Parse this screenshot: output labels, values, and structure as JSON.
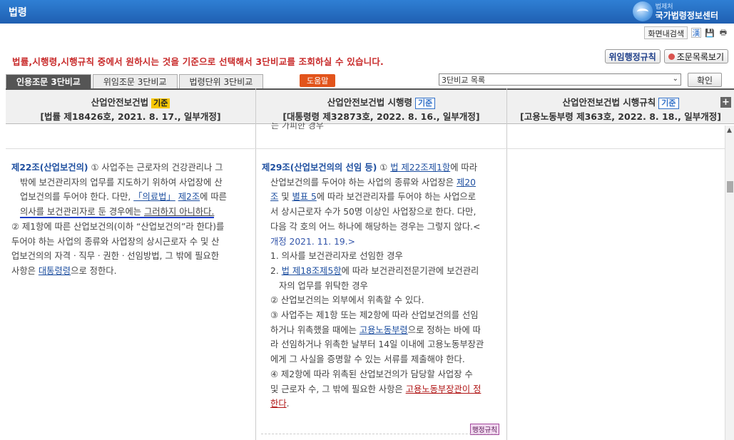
{
  "header": {
    "title": "법령",
    "brand_small": "법제처",
    "brand_big": "국가법령정보센터"
  },
  "tools": {
    "search_label": "화면내검색",
    "hanja_label": "漢",
    "save_label": "💾",
    "print_label": "🖶"
  },
  "notice": "법률,시행령,시행규칙 중에서 원하시는 것을 기준으로 선택해서 3단비교를 조회하실 수 있습니다.",
  "buttons": {
    "delegated_rules": "위임행정규칙",
    "article_list": "조문목록보기"
  },
  "tabs": [
    "인용조문 3단비교",
    "위임조문 3단비교",
    "법령단위 3단비교"
  ],
  "help_label": "도움말",
  "select": {
    "value": "3단비교 목록"
  },
  "confirm_label": "확인",
  "columns": [
    {
      "name": "산업안전보건법",
      "badge": "기준",
      "sub": "[법률 제18426호, 2021. 8. 17., 일부개정]"
    },
    {
      "name": "산업안전보건법 시행령",
      "badge": "기준",
      "sub": "[대통령령 제32873호, 2022. 8. 16., 일부개정]"
    },
    {
      "name": "산업안전보건법 시행규칙",
      "badge": "기준",
      "sub": "[고용노동부령 제363호, 2022. 8. 18., 일부개정]"
    }
  ],
  "cut_text": "는 가피한 경우",
  "law": {
    "title": "제22조(산업보건의)",
    "p1a": " ① 사업주는 근로자의 건강관리나 그",
    "p1b": "밖에 보건관리자의 업무를 지도하기 위하여 사업장에 산",
    "p1c": "업보건의를 두어야 한다. 다만, ",
    "link_medical": "「의료법」",
    "link_art2": "제2조",
    "p1d": "에 따른",
    "p1e_hl": "의사를 보건관리자로 둔 경우에는 ",
    "p1e_hl2": "그러하지 아니하다.",
    "p2a": "② 제1항에 따른 산업보건의(이하 “산업보건의”라 한다)를",
    "p2b": "두어야 하는 사업의 종류와 사업장의 상시근로자 수 및 산",
    "p2c": "업보건의의 자격ㆍ직무ㆍ권한ㆍ선임방법, 그 밖에 필요한",
    "p2d": "사항은 ",
    "link_decree": "대통령령",
    "p2e": "으로 정한다."
  },
  "decree": {
    "title": "제29조(산업보건의의 선임 등)",
    "l1a": " ① ",
    "link_law": "법",
    "link_law22": " 제22조제1항",
    "l1b": "에 따라",
    "l2a": "산업보건의를 두어야 하는 사업의 종류와 사업장은 ",
    "link_a20": "제20",
    "l3_link": "조",
    "l3a": " 및 ",
    "link_t5": "별표 5",
    "l3b": "에 따라 보건관리자를 두어야 하는 사업으로",
    "l4": "서 상시근로자 수가 50명 이상인 사업장으로 한다. 다만,",
    "l5": "다음 각 호의 어느 하나에 해당하는 경우는 그렇지 않다.<",
    "l6": "개정 2021. 11. 19.>",
    "i1": "1. 의사를 보건관리자로 선임한 경우",
    "i2a": "2. ",
    "i2_link": "법",
    "i2_link2": " 제18조제5항",
    "i2b": "에 따라 보건관리전문기관에 보건관리",
    "i2c": "자의 업무를 위탁한 경우",
    "p2": "② 산업보건의는 외부에서 위촉할 수 있다.",
    "p3a": "③ 사업주는 제1항 또는 제2항에 따라 산업보건의를 선임",
    "p3b": "하거나 위촉했을 때에는 ",
    "link_ministry": "고용노동부령",
    "p3c": "으로 정하는 바에 따",
    "p3d": "라 선임하거나 위촉한 날부터 14일 이내에 고용노동부장관",
    "p3e": "에게 그 사실을 증명할 수 있는 서류를 제출해야 한다.",
    "p4a": "④ 제2항에 따라 위촉된 산업보건의가 담당할 사업장 수",
    "p4b": "및 근로자 수, 그 밖에 필요한 사항은 ",
    "link_minister": "고용노동부장관이 정",
    "link_minister2": "한다",
    "p4c": ".",
    "rule_tag": "행정규칙"
  }
}
